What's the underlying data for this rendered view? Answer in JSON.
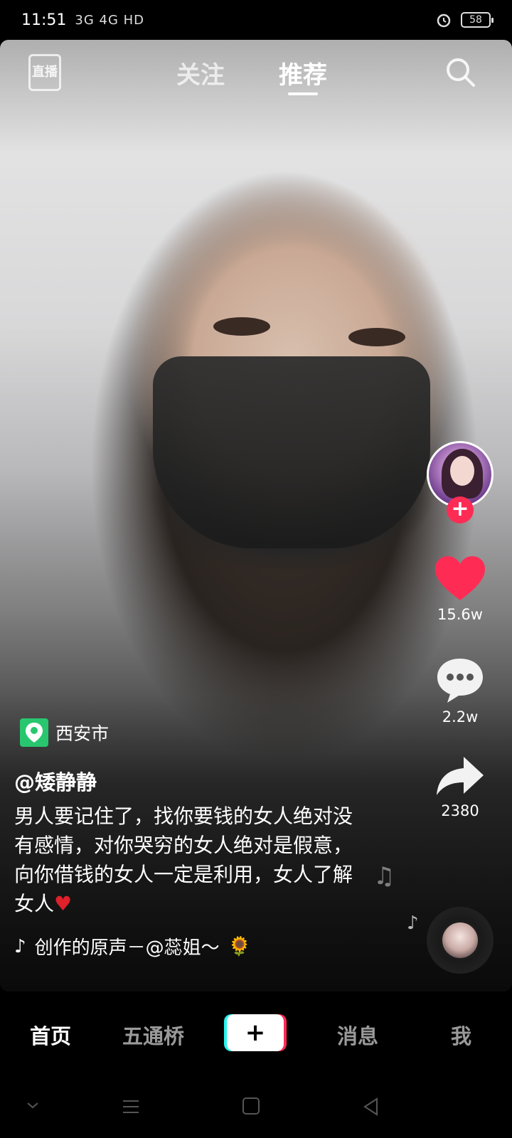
{
  "status_bar": {
    "time": "11:51",
    "network": "3G 4G HD",
    "battery": "58"
  },
  "top_nav": {
    "live_label": "直播",
    "tabs": [
      {
        "label": "关注",
        "active": false
      },
      {
        "label": "推荐",
        "active": true
      }
    ]
  },
  "actions": {
    "likes": "15.6w",
    "comments": "2.2w",
    "shares": "2380"
  },
  "post": {
    "location": "西安市",
    "author": "@矮静静",
    "description": "男人要记住了，找你要钱的女人绝对没有感情，对你哭穷的女人绝对是假意，向你借钱的女人一定是利用，女人了解女人",
    "description_emoji": "♥",
    "music": "创作的原声－@蕊姐～",
    "music_emoji": "🌻"
  },
  "bottom_tabs": {
    "home": "首页",
    "city": "五通桥",
    "create": "+",
    "messages": "消息",
    "me": "我"
  },
  "colors": {
    "like_red": "#fe2c55",
    "location_green": "#28c76f",
    "cyan_accent": "#25f4ee"
  },
  "icons": [
    "search-icon",
    "heart-icon",
    "comment-icon",
    "share-icon",
    "music-note-icon",
    "location-pin-icon",
    "alarm-icon"
  ]
}
